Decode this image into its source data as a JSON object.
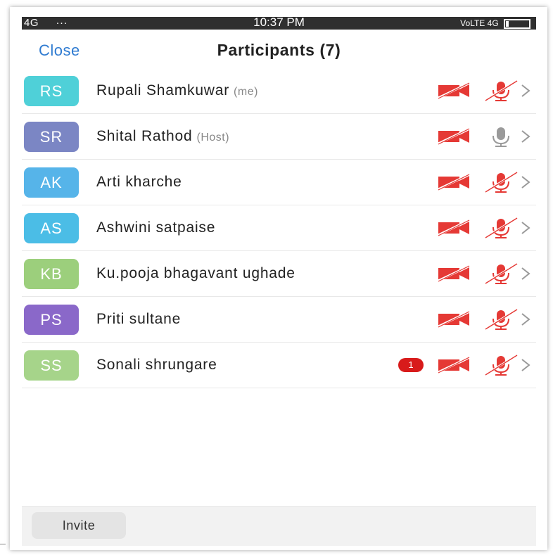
{
  "status_bar": {
    "left": "4G       ···",
    "time": "10:37 PM",
    "right": "VoLTE 4G"
  },
  "header": {
    "close_label": "Close",
    "title": "Participants (7)"
  },
  "colors": {
    "accent": "#2f7bd1",
    "muted_red": "#e53935",
    "mic_gray": "#9a9a9a"
  },
  "participants": [
    {
      "initials": "RS",
      "name": "Rupali Shamkuwar",
      "tag": "(me)",
      "avatar_color": "#4fd0d8",
      "video": "off",
      "audio": "muted",
      "badge": ""
    },
    {
      "initials": "SR",
      "name": "Shital Rathod",
      "tag": "(Host)",
      "avatar_color": "#7b86c4",
      "video": "off",
      "audio": "on",
      "badge": ""
    },
    {
      "initials": "AK",
      "name": "Arti kharche",
      "tag": "",
      "avatar_color": "#56b4e9",
      "video": "off",
      "audio": "muted",
      "badge": ""
    },
    {
      "initials": "AS",
      "name": "Ashwini satpaise",
      "tag": "",
      "avatar_color": "#4bbde6",
      "video": "off",
      "audio": "muted",
      "badge": ""
    },
    {
      "initials": "KB",
      "name": "Ku.pooja bhagavant ughade",
      "tag": "",
      "avatar_color": "#9ccf7c",
      "video": "off",
      "audio": "muted",
      "badge": ""
    },
    {
      "initials": "PS",
      "name": "Priti sultane",
      "tag": "",
      "avatar_color": "#8a68c9",
      "video": "off",
      "audio": "muted",
      "badge": ""
    },
    {
      "initials": "SS",
      "name": "Sonali shrungare",
      "tag": "",
      "avatar_color": "#a6d48a",
      "video": "off",
      "audio": "muted",
      "badge": "1"
    }
  ],
  "footer": {
    "invite_label": "Invite"
  }
}
